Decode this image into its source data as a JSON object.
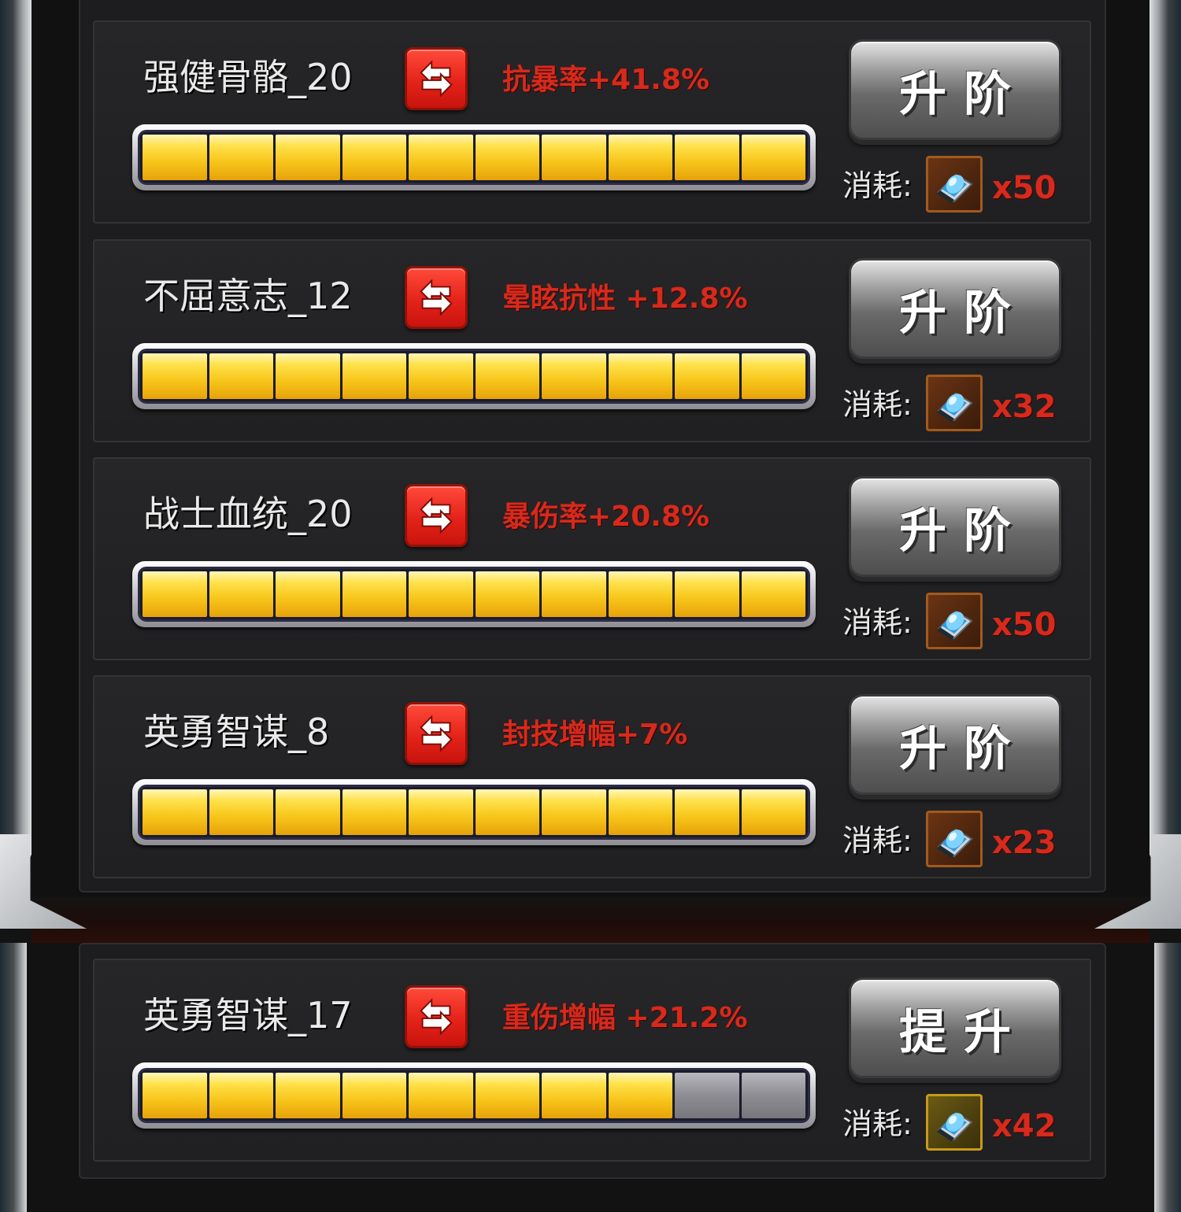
{
  "cost_label": "消耗:",
  "upgrade_label": "升阶",
  "rows": [
    {
      "name": "强健骨骼_20",
      "bonus": "抗暴率+41.8%",
      "button": "升阶",
      "cost_count": "x50",
      "filled": 10,
      "segments": 10
    },
    {
      "name": "不屈意志_12",
      "bonus": "晕眩抗性 +12.8%",
      "button": "升阶",
      "cost_count": "x32",
      "filled": 10,
      "segments": 10
    },
    {
      "name": "战士血统_20",
      "bonus": "暴伤率+20.8%",
      "button": "升阶",
      "cost_count": "x50",
      "filled": 10,
      "segments": 10
    },
    {
      "name": "英勇智谋_8",
      "bonus": "封技增幅+7%",
      "button": "升阶",
      "cost_count": "x23",
      "filled": 10,
      "segments": 10
    },
    {
      "name": "英勇智谋_17",
      "bonus": "重伤增幅 +21.2%",
      "button": "提升",
      "cost_count": "x42",
      "filled": 8,
      "segments": 10
    }
  ],
  "colors": {
    "bonus_text": "#d62a1c",
    "swap_button": "#e4231a",
    "bar_filled": "#f7c51a",
    "bar_empty": "#8d8d93"
  },
  "icons": {
    "swap": "swap-arrows-icon",
    "cost_item": "blue-crystal-book-icon"
  }
}
